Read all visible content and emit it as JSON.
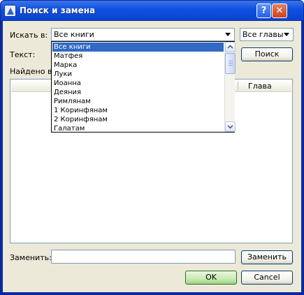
{
  "window": {
    "title": "Поиск и замена"
  },
  "titlebar": {
    "help_label": "?",
    "close_label": "✕"
  },
  "search_in": {
    "label": "Искать в:",
    "value": "Все книги"
  },
  "chapters": {
    "value": "Все главы"
  },
  "text": {
    "label": "Текст:"
  },
  "search_button": {
    "label": "Поиск"
  },
  "found": {
    "label": "Найдено в ф"
  },
  "results": {
    "columns": [
      "Глава"
    ]
  },
  "dropdown": {
    "items": [
      "Все книги",
      "Матфея",
      "Марка",
      "Луки",
      "Иоанна",
      "Деяния",
      "Римлянам",
      "1 Коринфянам",
      "2 Коринфянам",
      "Галатам"
    ],
    "selected": 0
  },
  "replace": {
    "label": "Заменить:",
    "button_label": "Заменить"
  },
  "ok_button": {
    "label": "OK"
  },
  "cancel_button": {
    "label": "Cancel"
  }
}
